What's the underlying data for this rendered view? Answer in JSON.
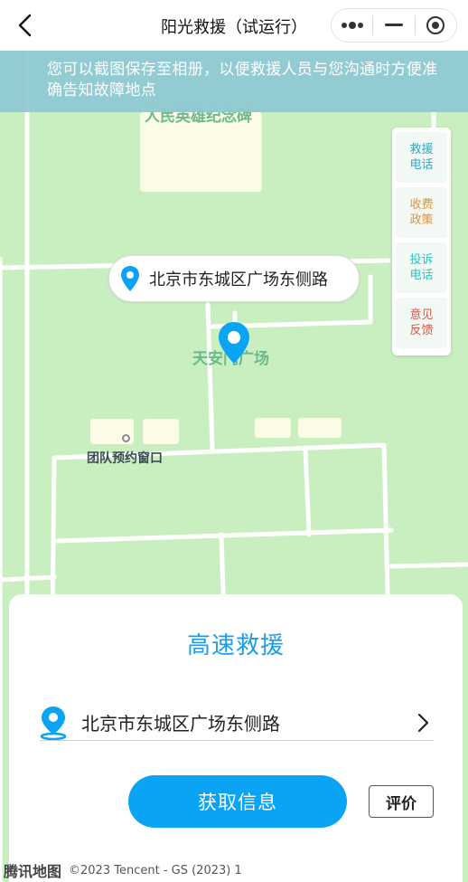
{
  "navbar": {
    "title": "阳光救援（试运行）"
  },
  "banner": {
    "text": "您可以截图保存至相册，以便救援人员与您沟通时方便准确告知故障地点"
  },
  "map": {
    "labels": {
      "landmark": "人民英雄纪念碑",
      "square": "天安门广场",
      "team_window": "团队预约窗口"
    },
    "logo": "腾讯地图",
    "copyright": "©2023 Tencent - GS (2023) 1"
  },
  "location_bubble": {
    "address": "北京市东城区广场东侧路"
  },
  "side_panel": {
    "items": [
      {
        "label": "救援电话",
        "color": "#28a9c7"
      },
      {
        "label": "收费政策",
        "color": "#e0923a"
      },
      {
        "label": "投诉电话",
        "color": "#31c0c0"
      },
      {
        "label": "意见反馈",
        "color": "#d25b4d"
      }
    ]
  },
  "card": {
    "title": "高速救援",
    "address": "北京市东城区广场东侧路",
    "primary_button": "获取信息",
    "secondary_button": "评价"
  },
  "colors": {
    "accent": "#0ba4f4",
    "map_bg": "#c9efc0",
    "banner_bg": "#8fc8d4"
  }
}
